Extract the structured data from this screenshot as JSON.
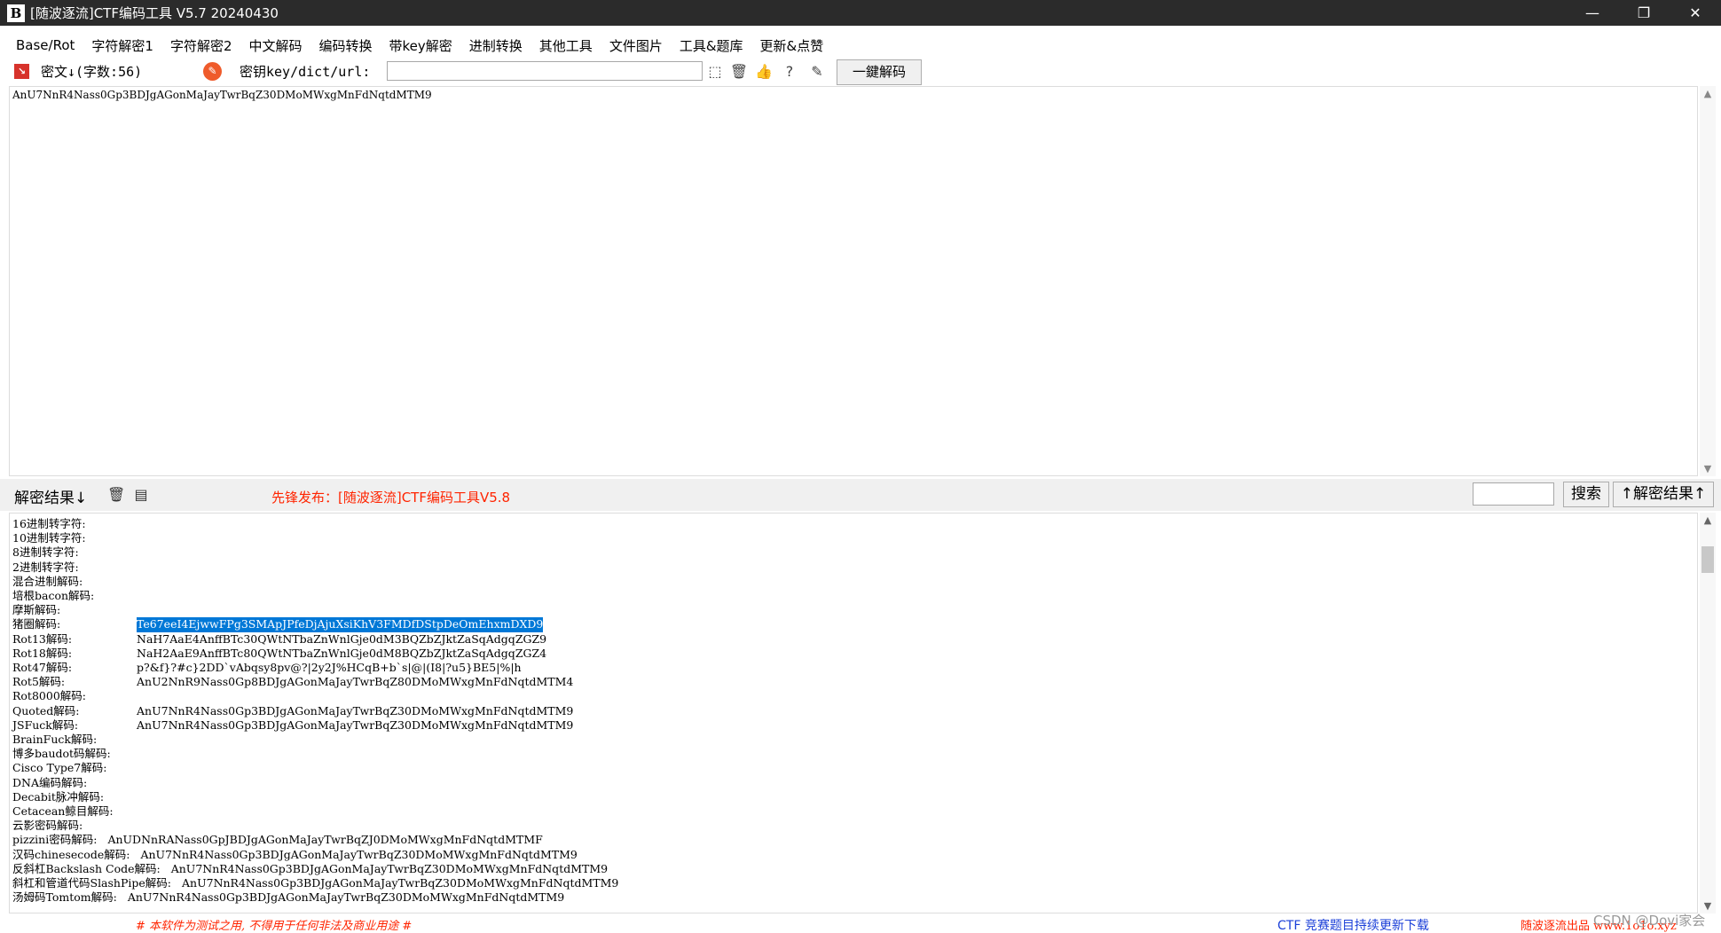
{
  "window": {
    "icon_text": "B",
    "title": "[随波逐流]CTF编码工具 V5.7 20240430",
    "minimize": "—",
    "restore": "❐",
    "close": "✕"
  },
  "menu": [
    "Base/Rot",
    "字符解密1",
    "字符解密2",
    "中文解码",
    "编码转换",
    "带key解密",
    "进制转换",
    "其他工具",
    "文件图片",
    "工具&题库",
    "更新&点赞"
  ],
  "toolbar": {
    "cipher_label": "密文↓(字数:56)",
    "key_label": "密钥key/dict/url:",
    "key_value": "",
    "decode_all_button": "一鍵解码"
  },
  "cipher": {
    "text": "AnU7NnR4Nass0Gp3BDJgAGonMaJayTwrBqZ30DMoMWxgMnFdNqtdMTM9"
  },
  "result_header": {
    "label": "解密结果↓",
    "announcement": "先锋发布：[随波逐流]CTF编码工具V5.8",
    "search_value": "",
    "search_button": "搜索",
    "result_up_button": "↑解密结果↑"
  },
  "results": [
    {
      "label": "16进制转字符:",
      "value": ""
    },
    {
      "label": "10进制转字符:",
      "value": ""
    },
    {
      "label": "8进制转字符:",
      "value": ""
    },
    {
      "label": "2进制转字符:",
      "value": ""
    },
    {
      "label": "混合进制解码:",
      "value": ""
    },
    {
      "label": "培根bacon解码:",
      "value": ""
    },
    {
      "label": "摩斯解码:",
      "value": ""
    },
    {
      "label": "猪圈解码:",
      "value": "Te67eeI4EjwwFPg3SMApJPfeDjAjuXsiKhV3FMDfDStpDeOmEhxmDXD9",
      "selected": true
    },
    {
      "label": "Rot13解码:",
      "value": "NaH7AaE4AnffBTc30QWtNTbaZnWnlGje0dM3BQZbZJktZaSqAdgqZGZ9"
    },
    {
      "label": "Rot18解码:",
      "value": "NaH2AaE9AnffBTc80QWtNTbaZnWnlGje0dM8BQZbZJktZaSqAdgqZGZ4"
    },
    {
      "label": "Rot47解码:",
      "value": "p?&f}?#c}2DD`vAbqsy8pv@?|2y2J%HCqB+b`s|@|(I8|?u5}BE5|%|h"
    },
    {
      "label": "Rot5解码:",
      "value": "AnU2NnR9Nass0Gp8BDJgAGonMaJayTwrBqZ80DMoMWxgMnFdNqtdMTM4"
    },
    {
      "label": "Rot8000解码:",
      "value": ""
    },
    {
      "label": "Quoted解码:",
      "value": "AnU7NnR4Nass0Gp3BDJgAGonMaJayTwrBqZ30DMoMWxgMnFdNqtdMTM9"
    },
    {
      "label": "JSFuck解码:",
      "value": "AnU7NnR4Nass0Gp3BDJgAGonMaJayTwrBqZ30DMoMWxgMnFdNqtdMTM9"
    },
    {
      "label": "BrainFuck解码:",
      "value": ""
    },
    {
      "label": "博多baudot码解码:",
      "value": ""
    },
    {
      "label": "Cisco Type7解码:",
      "value": ""
    },
    {
      "label": "DNA编码解码:",
      "value": ""
    },
    {
      "label": "Decabit脉冲解码:",
      "value": ""
    },
    {
      "label": "Cetacean鲸目解码:",
      "value": ""
    },
    {
      "label": "云影密码解码:",
      "value": ""
    },
    {
      "label": "pizzini密码解码:",
      "value": "AnUDNnRANass0GpJBDJgAGonMaJayTwrBqZJ0DMoMWxgMnFdNqtdMTMF",
      "free": true
    },
    {
      "label": "汉码chinesecode解码:",
      "value": "AnU7NnR4Nass0Gp3BDJgAGonMaJayTwrBqZ30DMoMWxgMnFdNqtdMTM9",
      "free": true
    },
    {
      "label": "反斜杠Backslash Code解码:",
      "value": "AnU7NnR4Nass0Gp3BDJgAGonMaJayTwrBqZ30DMoMWxgMnFdNqtdMTM9",
      "free": true
    },
    {
      "label": "斜杠和管道代码SlashPipe解码:",
      "value": "AnU7NnR4Nass0Gp3BDJgAGonMaJayTwrBqZ30DMoMWxgMnFdNqtdMTM9",
      "free": true
    },
    {
      "label": "汤姆码Tomtom解码:",
      "value": "AnU7NnR4Nass0Gp3BDJgAGonMaJayTwrBqZ30DMoMWxgMnFdNqtdMTM9",
      "free": true
    }
  ],
  "footer": {
    "disclaimer": "# 本软件为测试之用, 不得用于任何非法及商业用途 #",
    "update_link": "CTF 竞赛题目持续更新下载",
    "site": "随波逐流出品 www.1o1o.xyz",
    "watermark": "CSDN @Dovi家会"
  },
  "icons": [
    "app-icon",
    "cipher-icon",
    "key-icon",
    "pick-icon",
    "trash-icon",
    "thumbs-up-icon",
    "help-icon",
    "edit-icon",
    "result-trash-icon",
    "copy-icon"
  ]
}
